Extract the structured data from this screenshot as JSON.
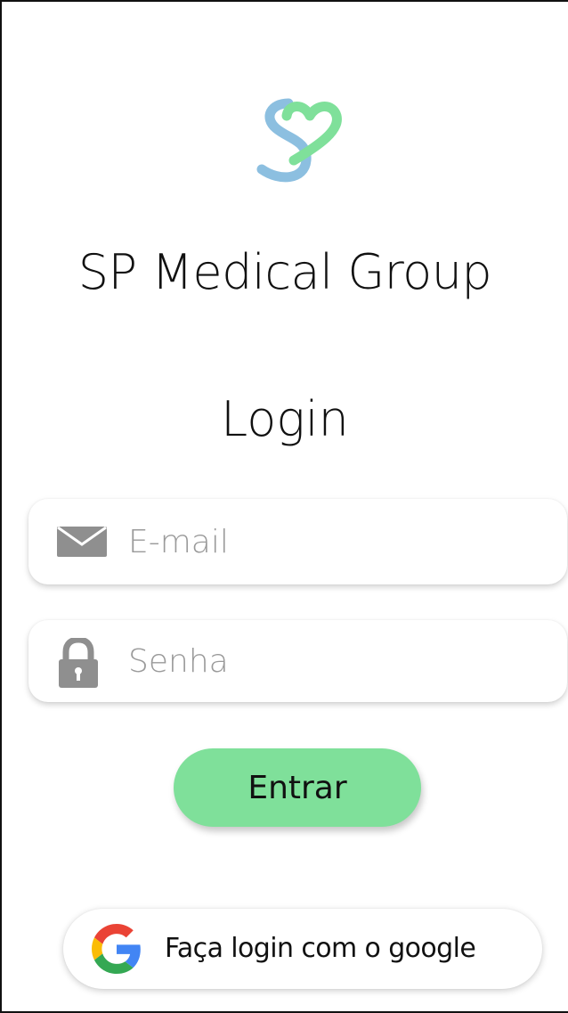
{
  "brand": {
    "app_name": "SP Medical Group",
    "logo_icon": "sp-heart-logo-icon",
    "colors": {
      "logo_blue": "#8cbfe0",
      "logo_green": "#7fe09a",
      "primary_button": "#7fe09a"
    }
  },
  "login": {
    "heading": "Login",
    "email": {
      "icon": "envelope-icon",
      "placeholder": "E-mail",
      "value": ""
    },
    "password": {
      "icon": "lock-icon",
      "placeholder": "Senha",
      "value": ""
    },
    "submit_label": "Entrar",
    "google": {
      "icon": "google-g-icon",
      "label": "Faça login com o google"
    }
  }
}
